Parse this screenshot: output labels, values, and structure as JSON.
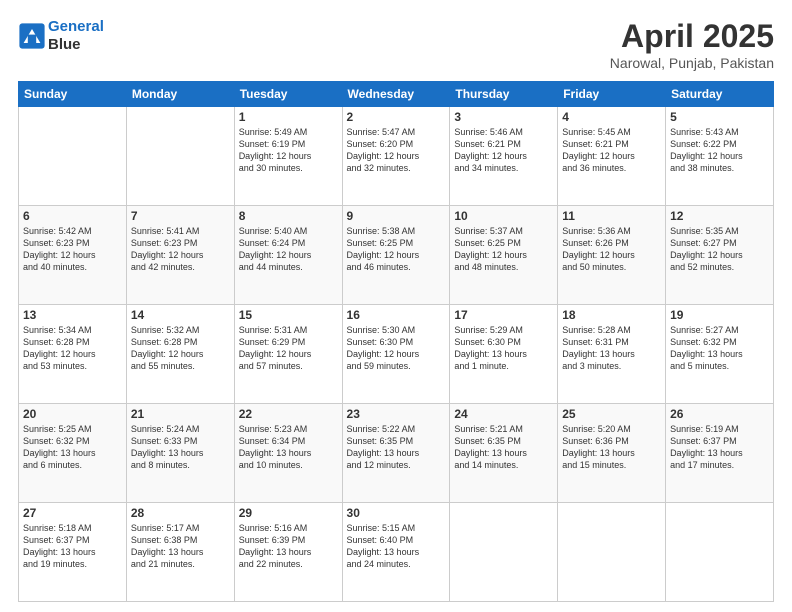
{
  "header": {
    "logo_line1": "General",
    "logo_line2": "Blue",
    "month": "April 2025",
    "location": "Narowal, Punjab, Pakistan"
  },
  "weekdays": [
    "Sunday",
    "Monday",
    "Tuesday",
    "Wednesday",
    "Thursday",
    "Friday",
    "Saturday"
  ],
  "weeks": [
    [
      {
        "day": "",
        "info": ""
      },
      {
        "day": "",
        "info": ""
      },
      {
        "day": "1",
        "info": "Sunrise: 5:49 AM\nSunset: 6:19 PM\nDaylight: 12 hours\nand 30 minutes."
      },
      {
        "day": "2",
        "info": "Sunrise: 5:47 AM\nSunset: 6:20 PM\nDaylight: 12 hours\nand 32 minutes."
      },
      {
        "day": "3",
        "info": "Sunrise: 5:46 AM\nSunset: 6:21 PM\nDaylight: 12 hours\nand 34 minutes."
      },
      {
        "day": "4",
        "info": "Sunrise: 5:45 AM\nSunset: 6:21 PM\nDaylight: 12 hours\nand 36 minutes."
      },
      {
        "day": "5",
        "info": "Sunrise: 5:43 AM\nSunset: 6:22 PM\nDaylight: 12 hours\nand 38 minutes."
      }
    ],
    [
      {
        "day": "6",
        "info": "Sunrise: 5:42 AM\nSunset: 6:23 PM\nDaylight: 12 hours\nand 40 minutes."
      },
      {
        "day": "7",
        "info": "Sunrise: 5:41 AM\nSunset: 6:23 PM\nDaylight: 12 hours\nand 42 minutes."
      },
      {
        "day": "8",
        "info": "Sunrise: 5:40 AM\nSunset: 6:24 PM\nDaylight: 12 hours\nand 44 minutes."
      },
      {
        "day": "9",
        "info": "Sunrise: 5:38 AM\nSunset: 6:25 PM\nDaylight: 12 hours\nand 46 minutes."
      },
      {
        "day": "10",
        "info": "Sunrise: 5:37 AM\nSunset: 6:25 PM\nDaylight: 12 hours\nand 48 minutes."
      },
      {
        "day": "11",
        "info": "Sunrise: 5:36 AM\nSunset: 6:26 PM\nDaylight: 12 hours\nand 50 minutes."
      },
      {
        "day": "12",
        "info": "Sunrise: 5:35 AM\nSunset: 6:27 PM\nDaylight: 12 hours\nand 52 minutes."
      }
    ],
    [
      {
        "day": "13",
        "info": "Sunrise: 5:34 AM\nSunset: 6:28 PM\nDaylight: 12 hours\nand 53 minutes."
      },
      {
        "day": "14",
        "info": "Sunrise: 5:32 AM\nSunset: 6:28 PM\nDaylight: 12 hours\nand 55 minutes."
      },
      {
        "day": "15",
        "info": "Sunrise: 5:31 AM\nSunset: 6:29 PM\nDaylight: 12 hours\nand 57 minutes."
      },
      {
        "day": "16",
        "info": "Sunrise: 5:30 AM\nSunset: 6:30 PM\nDaylight: 12 hours\nand 59 minutes."
      },
      {
        "day": "17",
        "info": "Sunrise: 5:29 AM\nSunset: 6:30 PM\nDaylight: 13 hours\nand 1 minute."
      },
      {
        "day": "18",
        "info": "Sunrise: 5:28 AM\nSunset: 6:31 PM\nDaylight: 13 hours\nand 3 minutes."
      },
      {
        "day": "19",
        "info": "Sunrise: 5:27 AM\nSunset: 6:32 PM\nDaylight: 13 hours\nand 5 minutes."
      }
    ],
    [
      {
        "day": "20",
        "info": "Sunrise: 5:25 AM\nSunset: 6:32 PM\nDaylight: 13 hours\nand 6 minutes."
      },
      {
        "day": "21",
        "info": "Sunrise: 5:24 AM\nSunset: 6:33 PM\nDaylight: 13 hours\nand 8 minutes."
      },
      {
        "day": "22",
        "info": "Sunrise: 5:23 AM\nSunset: 6:34 PM\nDaylight: 13 hours\nand 10 minutes."
      },
      {
        "day": "23",
        "info": "Sunrise: 5:22 AM\nSunset: 6:35 PM\nDaylight: 13 hours\nand 12 minutes."
      },
      {
        "day": "24",
        "info": "Sunrise: 5:21 AM\nSunset: 6:35 PM\nDaylight: 13 hours\nand 14 minutes."
      },
      {
        "day": "25",
        "info": "Sunrise: 5:20 AM\nSunset: 6:36 PM\nDaylight: 13 hours\nand 15 minutes."
      },
      {
        "day": "26",
        "info": "Sunrise: 5:19 AM\nSunset: 6:37 PM\nDaylight: 13 hours\nand 17 minutes."
      }
    ],
    [
      {
        "day": "27",
        "info": "Sunrise: 5:18 AM\nSunset: 6:37 PM\nDaylight: 13 hours\nand 19 minutes."
      },
      {
        "day": "28",
        "info": "Sunrise: 5:17 AM\nSunset: 6:38 PM\nDaylight: 13 hours\nand 21 minutes."
      },
      {
        "day": "29",
        "info": "Sunrise: 5:16 AM\nSunset: 6:39 PM\nDaylight: 13 hours\nand 22 minutes."
      },
      {
        "day": "30",
        "info": "Sunrise: 5:15 AM\nSunset: 6:40 PM\nDaylight: 13 hours\nand 24 minutes."
      },
      {
        "day": "",
        "info": ""
      },
      {
        "day": "",
        "info": ""
      },
      {
        "day": "",
        "info": ""
      }
    ]
  ]
}
